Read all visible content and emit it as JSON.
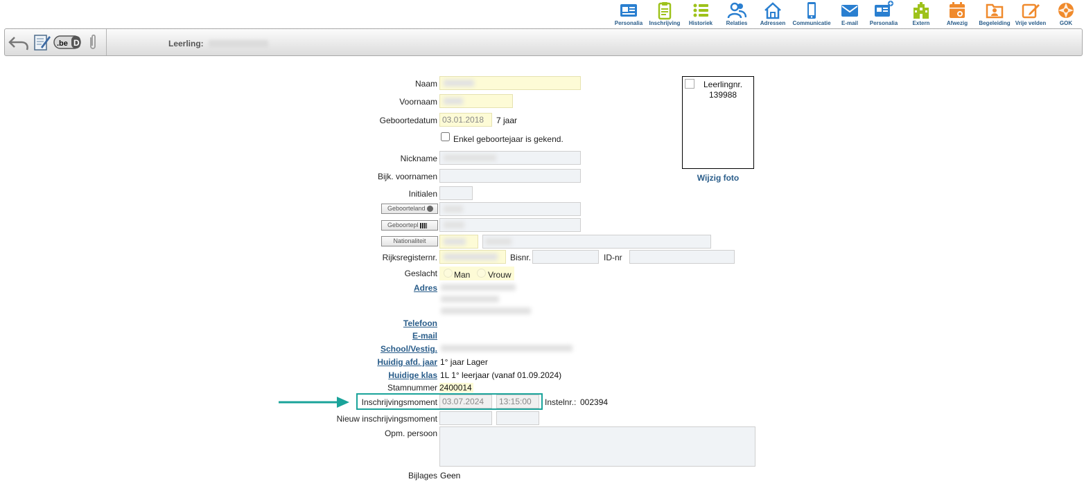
{
  "nav": [
    {
      "label": "Personalia",
      "icon": "id-card-icon",
      "color": "#2a7fd0"
    },
    {
      "label": "Inschrijving",
      "icon": "clipboard-icon",
      "color": "#9ec21b"
    },
    {
      "label": "Historiek",
      "icon": "list-icon",
      "color": "#9ec21b"
    },
    {
      "label": "Relaties",
      "icon": "users-icon",
      "color": "#2a7fd0"
    },
    {
      "label": "Adressen",
      "icon": "home-icon",
      "color": "#2a7fd0"
    },
    {
      "label": "Communicatie",
      "icon": "phone-icon",
      "color": "#2a7fd0"
    },
    {
      "label": "E-mail",
      "icon": "envelope-icon",
      "color": "#2a7fd0"
    },
    {
      "label": "Personalia",
      "icon": "id-card-plus-icon",
      "color": "#2a7fd0"
    },
    {
      "label": "Extern",
      "icon": "building-icon",
      "color": "#9ec21b"
    },
    {
      "label": "Afwezig",
      "icon": "calendar-icon",
      "color": "#f08a2c"
    },
    {
      "label": "Begeleiding",
      "icon": "folder-person-icon",
      "color": "#f08a2c"
    },
    {
      "label": "Vrije velden",
      "icon": "pencil-icon",
      "color": "#f08a2c"
    },
    {
      "label": "GOK",
      "icon": "gok-icon",
      "color": "#f08a2c"
    }
  ],
  "toolbar": {
    "student_label": "Leerling:",
    "eid_text": ".be"
  },
  "form": {
    "naam_label": "Naam",
    "voornaam_label": "Voornaam",
    "geboortedatum_label": "Geboortedatum",
    "geboortedatum_value": "03.01.2018",
    "age": "7 jaar",
    "enkel_geboortejaar_label": "Enkel geboortejaar is gekend.",
    "nickname_label": "Nickname",
    "bijk_voornamen_label": "Bijk.  voornamen",
    "initialen_label": "Initialen",
    "geboorteland_btn": "Geboorteland",
    "geboorteplaats_btn": "Geboortepl",
    "nationaliteit_btn": "Nationaliteit",
    "rijksregister_label": "Rijksregisternr.",
    "bisnr_label": "Bisnr.",
    "idnr_label": "ID-nr",
    "geslacht_label": "Geslacht",
    "man_label": "Man",
    "vrouw_label": "Vrouw",
    "adres_label": "Adres",
    "telefoon_label": "Telefoon",
    "email_label": "E-mail",
    "school_label": "School/Vestig.",
    "huidig_afd_label": "Huidig afd. jaar",
    "huidig_afd_value": "1° jaar Lager",
    "huidige_klas_label": "Huidige klas",
    "huidige_klas_value": "1L  1° leerjaar (vanaf 01.09.2024)",
    "stamnummer_label": "Stamnummer",
    "stamnummer_value": "2400014",
    "inschrijvingsmoment_label": "Inschrijvingsmoment",
    "inschrijvingsmoment_date": "03.07.2024",
    "inschrijvingsmoment_time": "13:15:00",
    "instelnr_label": "Instelnr.:",
    "instelnr_value": "002394",
    "nieuw_inschr_label": "Nieuw inschrijvingsmoment",
    "opm_persoon_label": "Opm.  persoon",
    "bijlages_label": "Bijlages",
    "bijlages_value": "Geen"
  },
  "photo": {
    "alt_text_line1": "Leerlingnr.",
    "alt_text_line2": "139988",
    "change_link": "Wijzig foto"
  },
  "colors": {
    "accent_blue": "#2a5d8a",
    "highlight": "#1aa39a",
    "yellow_field": "#fdfbd6"
  }
}
